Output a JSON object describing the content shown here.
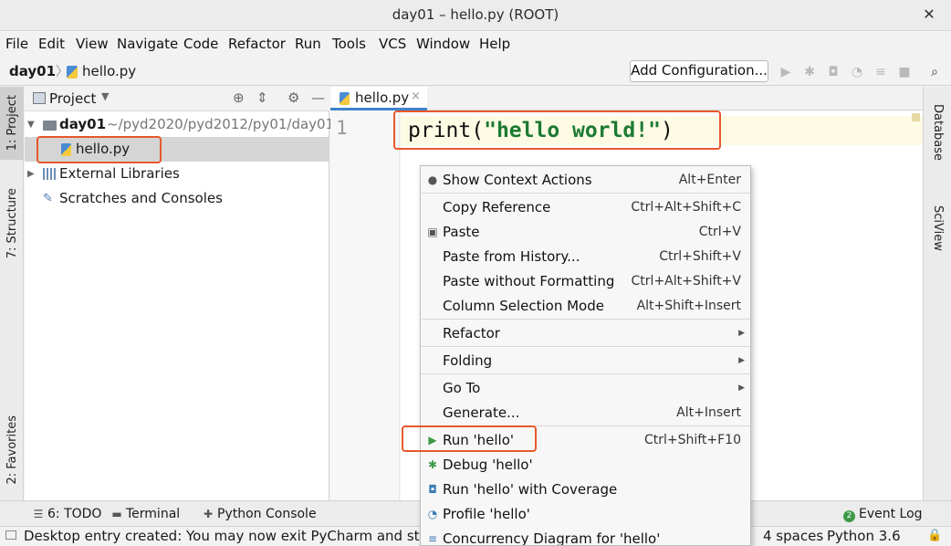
{
  "window": {
    "title": "day01 – hello.py (ROOT)",
    "close_glyph": "✕"
  },
  "menu": [
    "File",
    "Edit",
    "View",
    "Navigate",
    "Code",
    "Refactor",
    "Run",
    "Tools",
    "VCS",
    "Window",
    "Help"
  ],
  "navbar": {
    "project": "day01",
    "separator": "〉",
    "file": "hello.py",
    "add_configuration": "Add Configuration...",
    "toolbar_icons": [
      "run-icon",
      "debug-icon",
      "coverage-icon",
      "profile-icon",
      "concurrency-icon",
      "stop-icon",
      "search-icon"
    ]
  },
  "left_stripe": {
    "project": "1: Project",
    "structure": "7: Structure",
    "favorites": "2: Favorites"
  },
  "right_stripe": {
    "database": "Database",
    "sciview": "SciView"
  },
  "project_panel": {
    "title": "Project",
    "tree": {
      "root_name": "day01",
      "root_path": "~/pyd2020/pyd2012/py01/day01",
      "file": "hello.py",
      "external": "External Libraries",
      "scratches": "Scratches and Consoles"
    }
  },
  "editor": {
    "tab": "hello.py",
    "tab_close": "×",
    "line_number": "1",
    "code_func": "print",
    "code_open": "(",
    "code_string": "\"hello world!\"",
    "code_close": ")"
  },
  "context_menu": {
    "items": [
      {
        "label": "Show Context Actions",
        "shortcut": "Alt+Enter",
        "icon": "bulb-icon"
      },
      {
        "label": "Copy Reference",
        "shortcut": "Ctrl+Alt+Shift+C"
      },
      {
        "label": "Paste",
        "shortcut": "Ctrl+V",
        "icon": "paste-icon"
      },
      {
        "label": "Paste from History...",
        "shortcut": "Ctrl+Shift+V"
      },
      {
        "label": "Paste without Formatting",
        "shortcut": "Ctrl+Alt+Shift+V"
      },
      {
        "label": "Column Selection Mode",
        "shortcut": "Alt+Shift+Insert"
      },
      {
        "label": "Refactor",
        "submenu": true
      },
      {
        "label": "Folding",
        "submenu": true
      },
      {
        "label": "Go To",
        "submenu": true
      },
      {
        "label": "Generate...",
        "shortcut": "Alt+Insert"
      },
      {
        "label": "Run 'hello'",
        "shortcut": "Ctrl+Shift+F10",
        "icon": "run-icon"
      },
      {
        "label": "Debug 'hello'",
        "icon": "debug-icon"
      },
      {
        "label": "Run 'hello' with Coverage",
        "icon": "coverage-icon"
      },
      {
        "label": "Profile 'hello'",
        "icon": "profile-icon"
      },
      {
        "label": "Concurrency Diagram for 'hello'",
        "icon": "concurrency-icon"
      }
    ]
  },
  "bottom_tools": {
    "todo": "6: TODO",
    "terminal": "Terminal",
    "python_console": "Python Console",
    "event_log": "Event Log",
    "event_count": "2"
  },
  "status": {
    "message": "Desktop entry created: You may now exit PyCharm and start it f",
    "indent": "4 spaces",
    "interpreter": "Python 3.6"
  },
  "colors": {
    "accent": "#4083c9",
    "highlight_box": "#e8582c",
    "string": "#1c7a32",
    "run_green": "#3c9a46"
  }
}
